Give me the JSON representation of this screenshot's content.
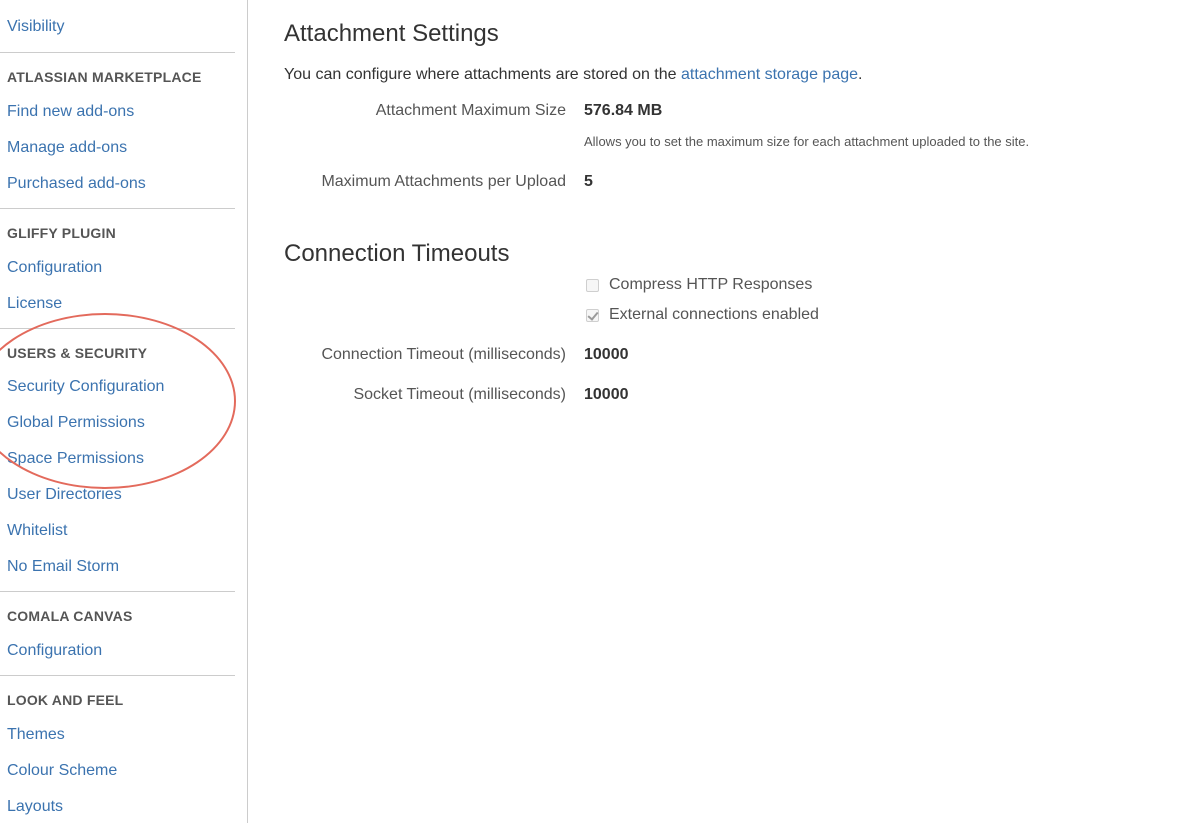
{
  "sidebar": {
    "top_link": "Visibility",
    "sections": [
      {
        "title": "ATLASSIAN MARKETPLACE",
        "items": [
          "Find new add-ons",
          "Manage add-ons",
          "Purchased add-ons"
        ]
      },
      {
        "title": "GLIFFY PLUGIN",
        "items": [
          "Configuration",
          "License"
        ]
      },
      {
        "title": "USERS & SECURITY",
        "items": [
          "Security Configuration",
          "Global Permissions",
          "Space Permissions",
          "User Directories",
          "Whitelist",
          "No Email Storm"
        ]
      },
      {
        "title": "COMALA CANVAS",
        "items": [
          "Configuration"
        ]
      },
      {
        "title": "LOOK AND FEEL",
        "items": [
          "Themes",
          "Colour Scheme",
          "Layouts"
        ]
      }
    ]
  },
  "annotation": {
    "color": "#e36a5c"
  },
  "attachment": {
    "heading": "Attachment Settings",
    "intro_text": "You can configure where attachments are stored on the ",
    "intro_link": "attachment storage page",
    "intro_end": ".",
    "max_size_label": "Attachment Maximum Size",
    "max_size_value": "576.84 MB",
    "max_size_desc": "Allows you to set the maximum size for each attachment uploaded to the site.",
    "max_per_upload_label": "Maximum Attachments per Upload",
    "max_per_upload_value": "5"
  },
  "connection": {
    "heading": "Connection Timeouts",
    "compress_label": "Compress HTTP Responses",
    "compress_checked": false,
    "external_label": "External connections enabled",
    "external_checked": true,
    "conn_timeout_label": "Connection Timeout (milliseconds)",
    "conn_timeout_value": "10000",
    "socket_timeout_label": "Socket Timeout (milliseconds)",
    "socket_timeout_value": "10000"
  },
  "colors": {
    "link": "#3b73af",
    "text": "#333333",
    "muted": "#555555",
    "divider": "#cccccc"
  }
}
